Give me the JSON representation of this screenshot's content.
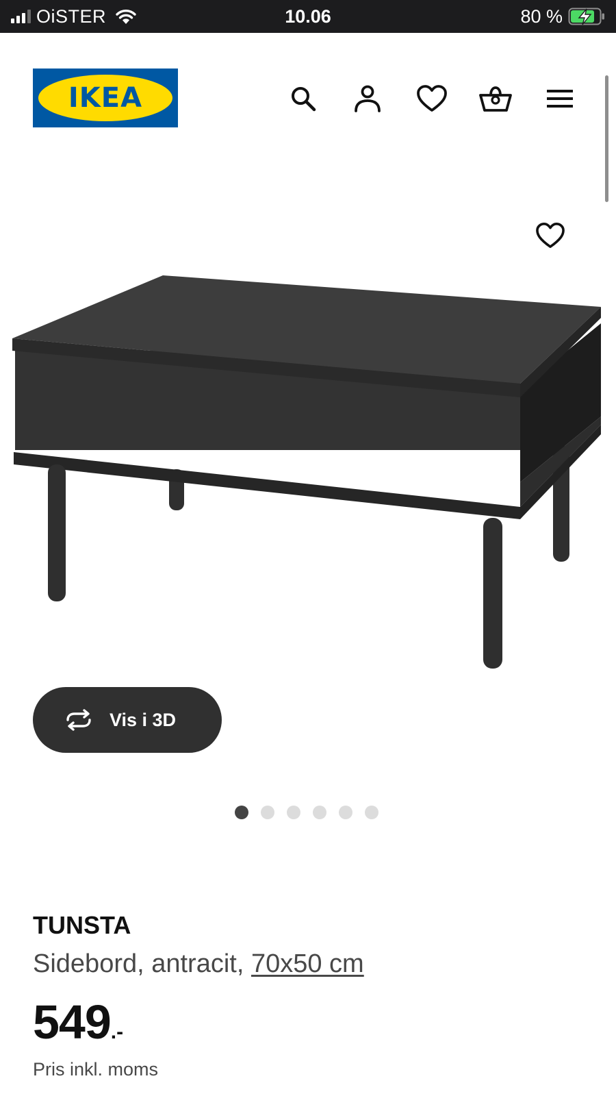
{
  "status_bar": {
    "carrier": "OiSTER",
    "time": "10.06",
    "battery_percent": "80 %",
    "signal_bars": 3,
    "charging": true
  },
  "header": {
    "logo_text": "IKEA",
    "icons": [
      "search-icon",
      "account-icon",
      "favourites-icon",
      "basket-icon",
      "menu-icon"
    ]
  },
  "colors": {
    "brand_blue": "#0058a3",
    "brand_yellow": "#ffdb00",
    "button_dark": "#303030",
    "battery_green": "#4cd964"
  },
  "product": {
    "name": "TUNSTA",
    "description": "Sidebord, antracit, ",
    "size": "70x50 cm",
    "price": "549",
    "price_suffix": ".-",
    "price_note": "Pris inkl. moms"
  },
  "viewer": {
    "button_3d_label": "Vis i 3D",
    "image_count": 6,
    "active_image": 1
  }
}
